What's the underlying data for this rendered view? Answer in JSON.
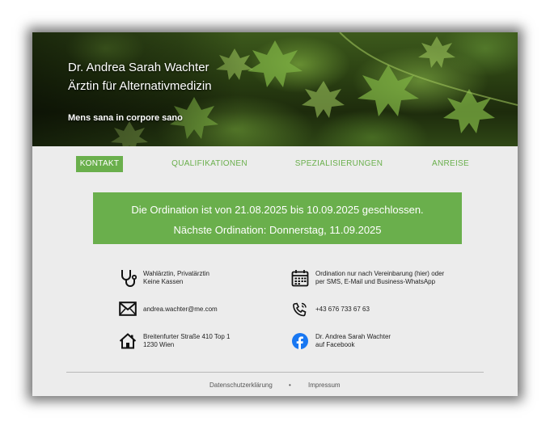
{
  "hero": {
    "name": "Dr. Andrea Sarah Wachter",
    "title": "Ärztin für Alternativmedizin",
    "motto": "Mens sana in corpore sano"
  },
  "nav": {
    "items": [
      {
        "label": "KONTAKT",
        "active": true
      },
      {
        "label": "QUALIFIKATIONEN",
        "active": false
      },
      {
        "label": "SPEZIALISIERUNGEN",
        "active": false
      },
      {
        "label": "ANREISE",
        "active": false
      }
    ]
  },
  "notice": {
    "line1": "Die Ordination ist von 21.08.2025 bis 10.09.2025 geschlossen.",
    "line2": "Nächste Ordination: Donnerstag, 11.09.2025"
  },
  "info": {
    "doctor": {
      "icon": "stethoscope-icon",
      "line1": "Wahlärztin, Privatärztin",
      "line2": "Keine Kassen"
    },
    "appointment": {
      "icon": "calendar-icon",
      "line1": "Ordination nur nach Vereinbarung (hier) oder",
      "line2": "per SMS, E-Mail und Business-WhatsApp"
    },
    "email": {
      "icon": "envelope-icon",
      "text": "andrea.wachter@me.com"
    },
    "phone": {
      "icon": "phone-icon",
      "text": "+43 676 733 67 63"
    },
    "address": {
      "icon": "house-icon",
      "line1": "Breitenfurter Straße 410 Top 1",
      "line2": "1230 Wien"
    },
    "facebook": {
      "icon": "facebook-icon",
      "line1": "Dr. Andrea Sarah Wachter",
      "line2": "auf Facebook"
    }
  },
  "footer": {
    "privacy": "Datenschutzerklärung",
    "separator": "•",
    "imprint": "Impressum"
  },
  "colors": {
    "accent": "#6aaf4c",
    "background": "#ececec",
    "facebook": "#1877f2"
  }
}
